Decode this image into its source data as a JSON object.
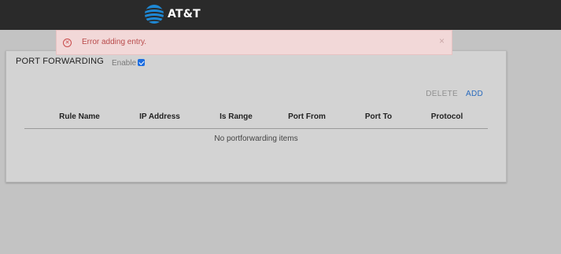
{
  "header": {
    "brand": "AT&T",
    "logo_icon": "globe-icon",
    "brand_color": "#1e88d4"
  },
  "alert": {
    "icon": "error-circle-icon",
    "message": "Error adding entry.",
    "close": "×",
    "color": "#b84a4a"
  },
  "panel": {
    "title": "PORT FORWARDING",
    "enable_label": "Enable",
    "enable_checked": true,
    "actions": {
      "delete": "DELETE",
      "add": "ADD"
    },
    "columns": [
      "Rule Name",
      "IP Address",
      "Is Range",
      "Port From",
      "Port To",
      "Protocol"
    ],
    "empty_message": "No portforwarding items"
  }
}
